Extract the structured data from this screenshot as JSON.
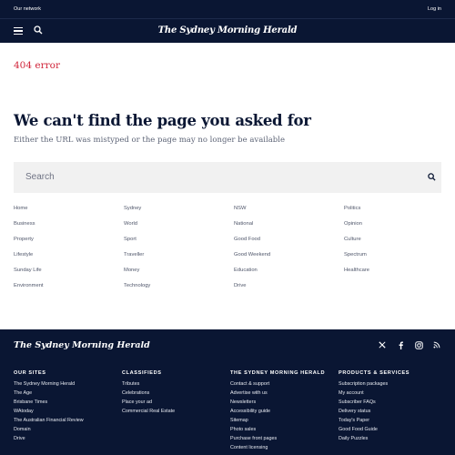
{
  "topbar": {
    "network": "Our network",
    "login": "Log in"
  },
  "masthead": {
    "logo": "The Sydney Morning Herald",
    "menu_icon": "menu-icon",
    "search_icon": "search-icon"
  },
  "error": {
    "code": "404 error",
    "headline": "We can't find the page you asked for",
    "subtext": "Either the URL was mistyped or the page may no longer be available"
  },
  "search": {
    "placeholder": "Search"
  },
  "links": [
    [
      "Home",
      "Business",
      "Property",
      "Lifestyle",
      "Sunday Life",
      "Environment"
    ],
    [
      "Sydney",
      "World",
      "Sport",
      "Traveller",
      "Money",
      "Technology"
    ],
    [
      "NSW",
      "National",
      "Good Food",
      "Good Weekend",
      "Education",
      "Drive"
    ],
    [
      "Politics",
      "Opinion",
      "Culture",
      "Spectrum",
      "Healthcare"
    ]
  ],
  "footer": {
    "logo": "The Sydney Morning Herald",
    "social_icons": [
      "x-icon",
      "facebook-icon",
      "instagram-icon",
      "rss-icon"
    ],
    "columns": [
      {
        "heading": "OUR SITES",
        "items": [
          "The Sydney Morning Herald",
          "The Age",
          "Brisbane Times",
          "WAtoday",
          "The Australian Financial Review",
          "Domain",
          "Drive"
        ]
      },
      {
        "heading": "CLASSIFIEDS",
        "items": [
          "Tributes",
          "Celebrations",
          "Place your ad",
          "Commercial Real Estate"
        ]
      },
      {
        "heading": "THE SYDNEY MORNING HERALD",
        "items": [
          "Contact & support",
          "Advertise with us",
          "Newsletters",
          "Accessibility guide",
          "Sitemap",
          "Photo sales",
          "Purchase front pages",
          "Content licensing"
        ]
      },
      {
        "heading": "PRODUCTS & SERVICES",
        "items": [
          "Subscription packages",
          "My account",
          "Subscriber FAQs",
          "Delivery status",
          "Today's Paper",
          "Good Food Guide",
          "Daily Puzzles"
        ]
      }
    ]
  },
  "colors": {
    "navy": "#0a1633",
    "error_red": "#d1263b",
    "search_bg": "#f1f1f1"
  }
}
